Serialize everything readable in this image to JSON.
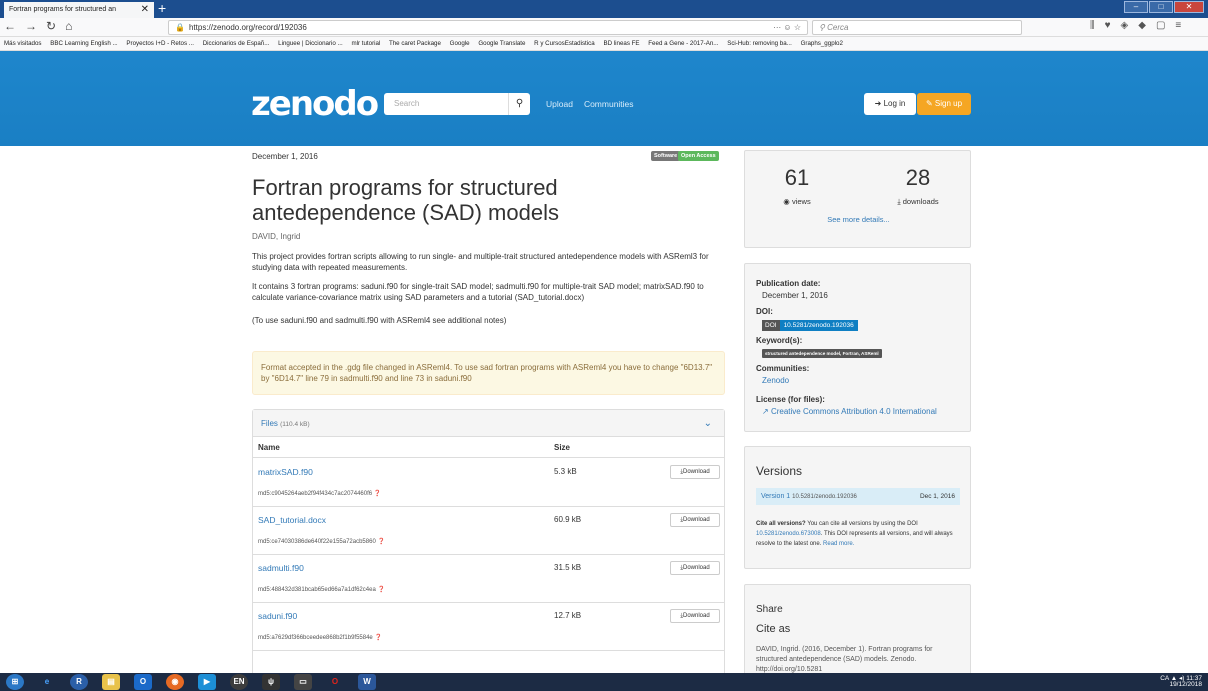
{
  "browser": {
    "tab_title": "Fortran programs for structured an",
    "tab_close": "✕",
    "new_tab": "+",
    "url": "https://zenodo.org/record/192036",
    "url_tools": "··· ☺ ☆",
    "search_placeholder": "Cerca",
    "bookmarks": [
      "Más visitados",
      "BBC Learning English ...",
      "Proyectos I+D - Retos ...",
      "Diccionarios de Españ...",
      "Linguee | Diccionario ...",
      "mlr tutorial",
      "The caret Package",
      "Google",
      "Google Translate",
      "R y CursosEstadistica",
      "BD lineas FE",
      "Feed a Gene - 2017-An...",
      "Sci-Hub: removing ba...",
      "Graphs_ggplo2"
    ]
  },
  "header": {
    "logo": "zenodo",
    "search_placeholder": "Search",
    "nav": [
      "Upload",
      "Communities"
    ],
    "login": "Log in",
    "signup": "Sign up"
  },
  "record": {
    "date": "December 1, 2016",
    "badges": [
      "Software",
      "Open Access"
    ],
    "title": "Fortran programs for structured antedependence (SAD) models",
    "author": "DAVID, Ingrid",
    "description": [
      "This project provides fortran scripts allowing to run single- and multiple-trait structured antedependence models with ASReml3 for studying data with repeated measurements.",
      "It contains 3 fortran programs: saduni.f90 for single-trait SAD model; sadmulti.f90 for multiple-trait SAD model; matrixSAD.f90 to calculate variance-covariance matrix using SAD parameters and a tutorial (SAD_tutorial.docx)",
      "(To use saduni.f90 and sadmulti.f90 with ASReml4 see additional notes)"
    ],
    "alert": "Format accepted in the .gdg file changed in ASReml4. To use sad fortran programs with ASReml4 you have to change \"6D13.7\" by \"6D14.7\" line 79 in sadmulti.f90 and line 73 in saduni.f90"
  },
  "files": {
    "title": "Files",
    "total_size": "(110.4 kB)",
    "col_name": "Name",
    "col_size": "Size",
    "download_label": "Download",
    "rows": [
      {
        "name": "matrixSAD.f90",
        "size": "5.3 kB",
        "md5": "md5:c9045264aeb2f94f434c7ac2074460f6"
      },
      {
        "name": "SAD_tutorial.docx",
        "size": "60.9 kB",
        "md5": "md5:ce74030386de640f22e155a72acb5860"
      },
      {
        "name": "sadmulti.f90",
        "size": "31.5 kB",
        "md5": "md5:488432d381bcab65ed66a7a1df62c4ea"
      },
      {
        "name": "saduni.f90",
        "size": "12.7 kB",
        "md5": "md5:a7629df366bceedee868b2f1b9f5584e"
      }
    ]
  },
  "stats": {
    "views": "61",
    "views_label": "views",
    "downloads": "28",
    "downloads_label": "downloads",
    "more": "See more details..."
  },
  "meta": {
    "pubdate_label": "Publication date:",
    "pubdate": "December 1, 2016",
    "doi_label": "DOI:",
    "doi_prefix": "DOI",
    "doi": "10.5281/zenodo.192036",
    "keywords_label": "Keyword(s):",
    "keywords": "structured antedependence model, Fortran, ASReml",
    "communities_label": "Communities:",
    "community": "Zenodo",
    "license_label": "License (for files):",
    "license": "Creative Commons Attribution 4.0 International"
  },
  "versions": {
    "title": "Versions",
    "row_label": "Version 1",
    "row_doi": "10.5281/zenodo.192036",
    "row_date": "Dec 1, 2016",
    "cite_all_bold": "Cite all versions?",
    "cite_all_text": "You can cite all versions by using the DOI",
    "concept_doi": "10.5281/zenodo.673008",
    "cite_all_text2": ". This DOI represents all versions, and will always resolve to the latest one.",
    "read_more": "Read more."
  },
  "share": {
    "title": "Share",
    "cite_as": "Cite as",
    "citation": "DAVID, Ingrid. (2016, December 1). Fortran programs for structured antedependence (SAD) models. Zenodo. http://doi.org/10.5281"
  },
  "taskbar": {
    "lang": "CA",
    "time": "11:37",
    "date": "19/12/2018"
  },
  "colors": {
    "header_blue": "#1a7fc4",
    "link_blue": "#337ab7",
    "signup_orange": "#f5a623",
    "open_access_green": "#5cb85c"
  }
}
